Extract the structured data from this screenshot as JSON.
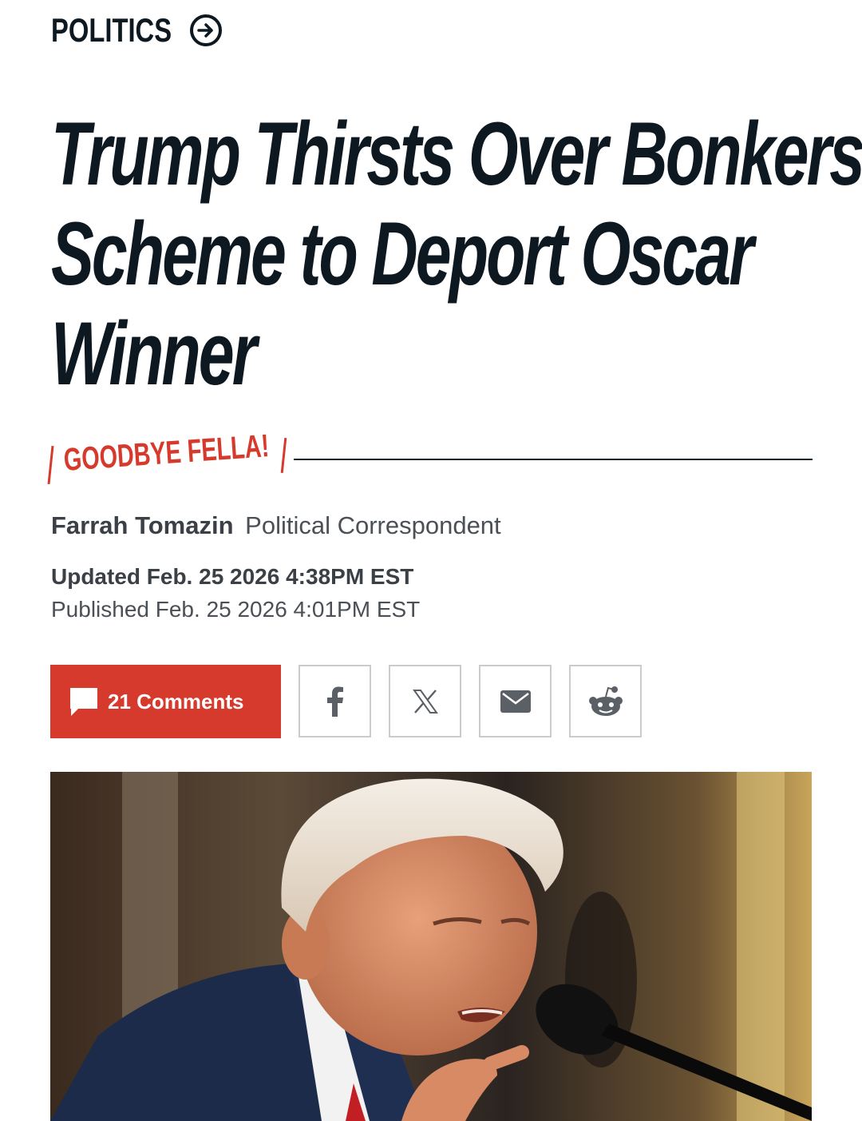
{
  "section": {
    "label": "POLITICS",
    "arrow_icon": "arrow-right-circle-icon"
  },
  "headline": {
    "lines": [
      "Trump Thirsts Over Bonkers",
      "Scheme to Deport Oscar",
      "Winner"
    ]
  },
  "kicker": "GOODBYE FELLA!",
  "byline": {
    "author": "Farrah Tomazin",
    "role": "Political Correspondent"
  },
  "timestamps": {
    "updated": "Updated Feb. 25 2026 4:38PM EST",
    "published": "Published Feb. 25 2026 4:01PM EST"
  },
  "share": {
    "comments_label": "21 Comments",
    "buttons": [
      "facebook-icon",
      "x-icon",
      "email-icon",
      "reddit-icon"
    ]
  },
  "colors": {
    "accent": "#d63a2c",
    "text": "#0d1821",
    "border": "#c9cbcd"
  }
}
